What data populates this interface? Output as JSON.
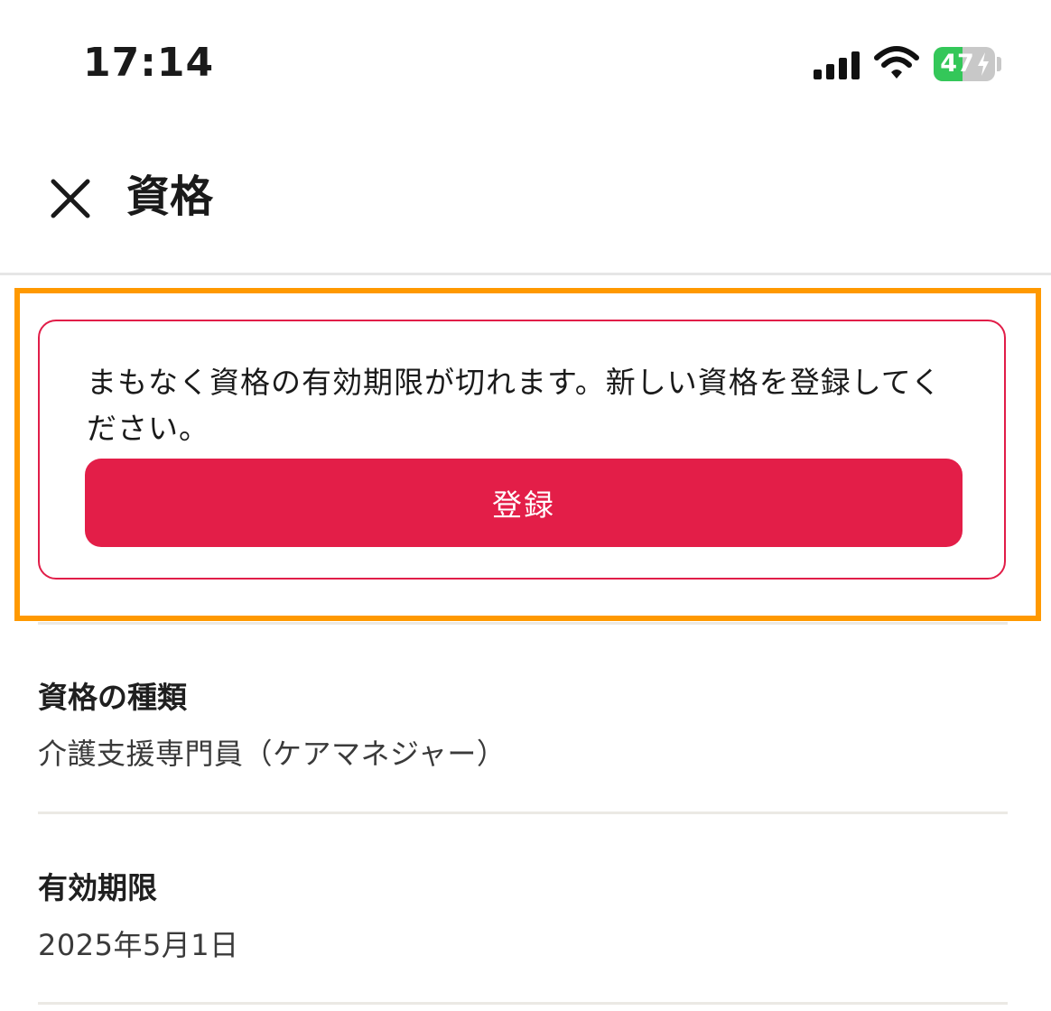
{
  "status_bar": {
    "time": "17:14",
    "battery_level": "47",
    "battery_fraction": 0.47,
    "icons": [
      "signal-icon",
      "wifi-icon",
      "battery-charging-icon"
    ]
  },
  "header": {
    "title": "資格",
    "close_icon": "close-icon"
  },
  "alert": {
    "message": "まもなく資格の有効期限が切れます。新しい資格を登録してください。",
    "button_label": "登録",
    "border_color": "#e11d48",
    "button_color": "#e31e48",
    "highlight_color": "#ff9900"
  },
  "details": [
    {
      "label": "資格の種類",
      "value": "介護支援専門員（ケアマネジャー）"
    },
    {
      "label": "有効期限",
      "value": "2025年5月1日"
    }
  ]
}
